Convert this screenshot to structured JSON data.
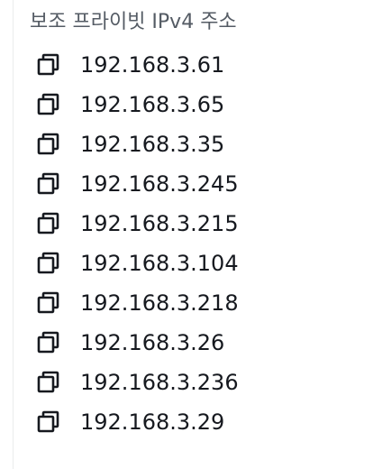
{
  "section": {
    "title": "보조 프라이빗 IPv4 주소",
    "copy_icon": "copy-icon",
    "addresses": [
      "192.168.3.61",
      "192.168.3.65",
      "192.168.3.35",
      "192.168.3.245",
      "192.168.3.215",
      "192.168.3.104",
      "192.168.3.218",
      "192.168.3.26",
      "192.168.3.236",
      "192.168.3.29"
    ]
  }
}
